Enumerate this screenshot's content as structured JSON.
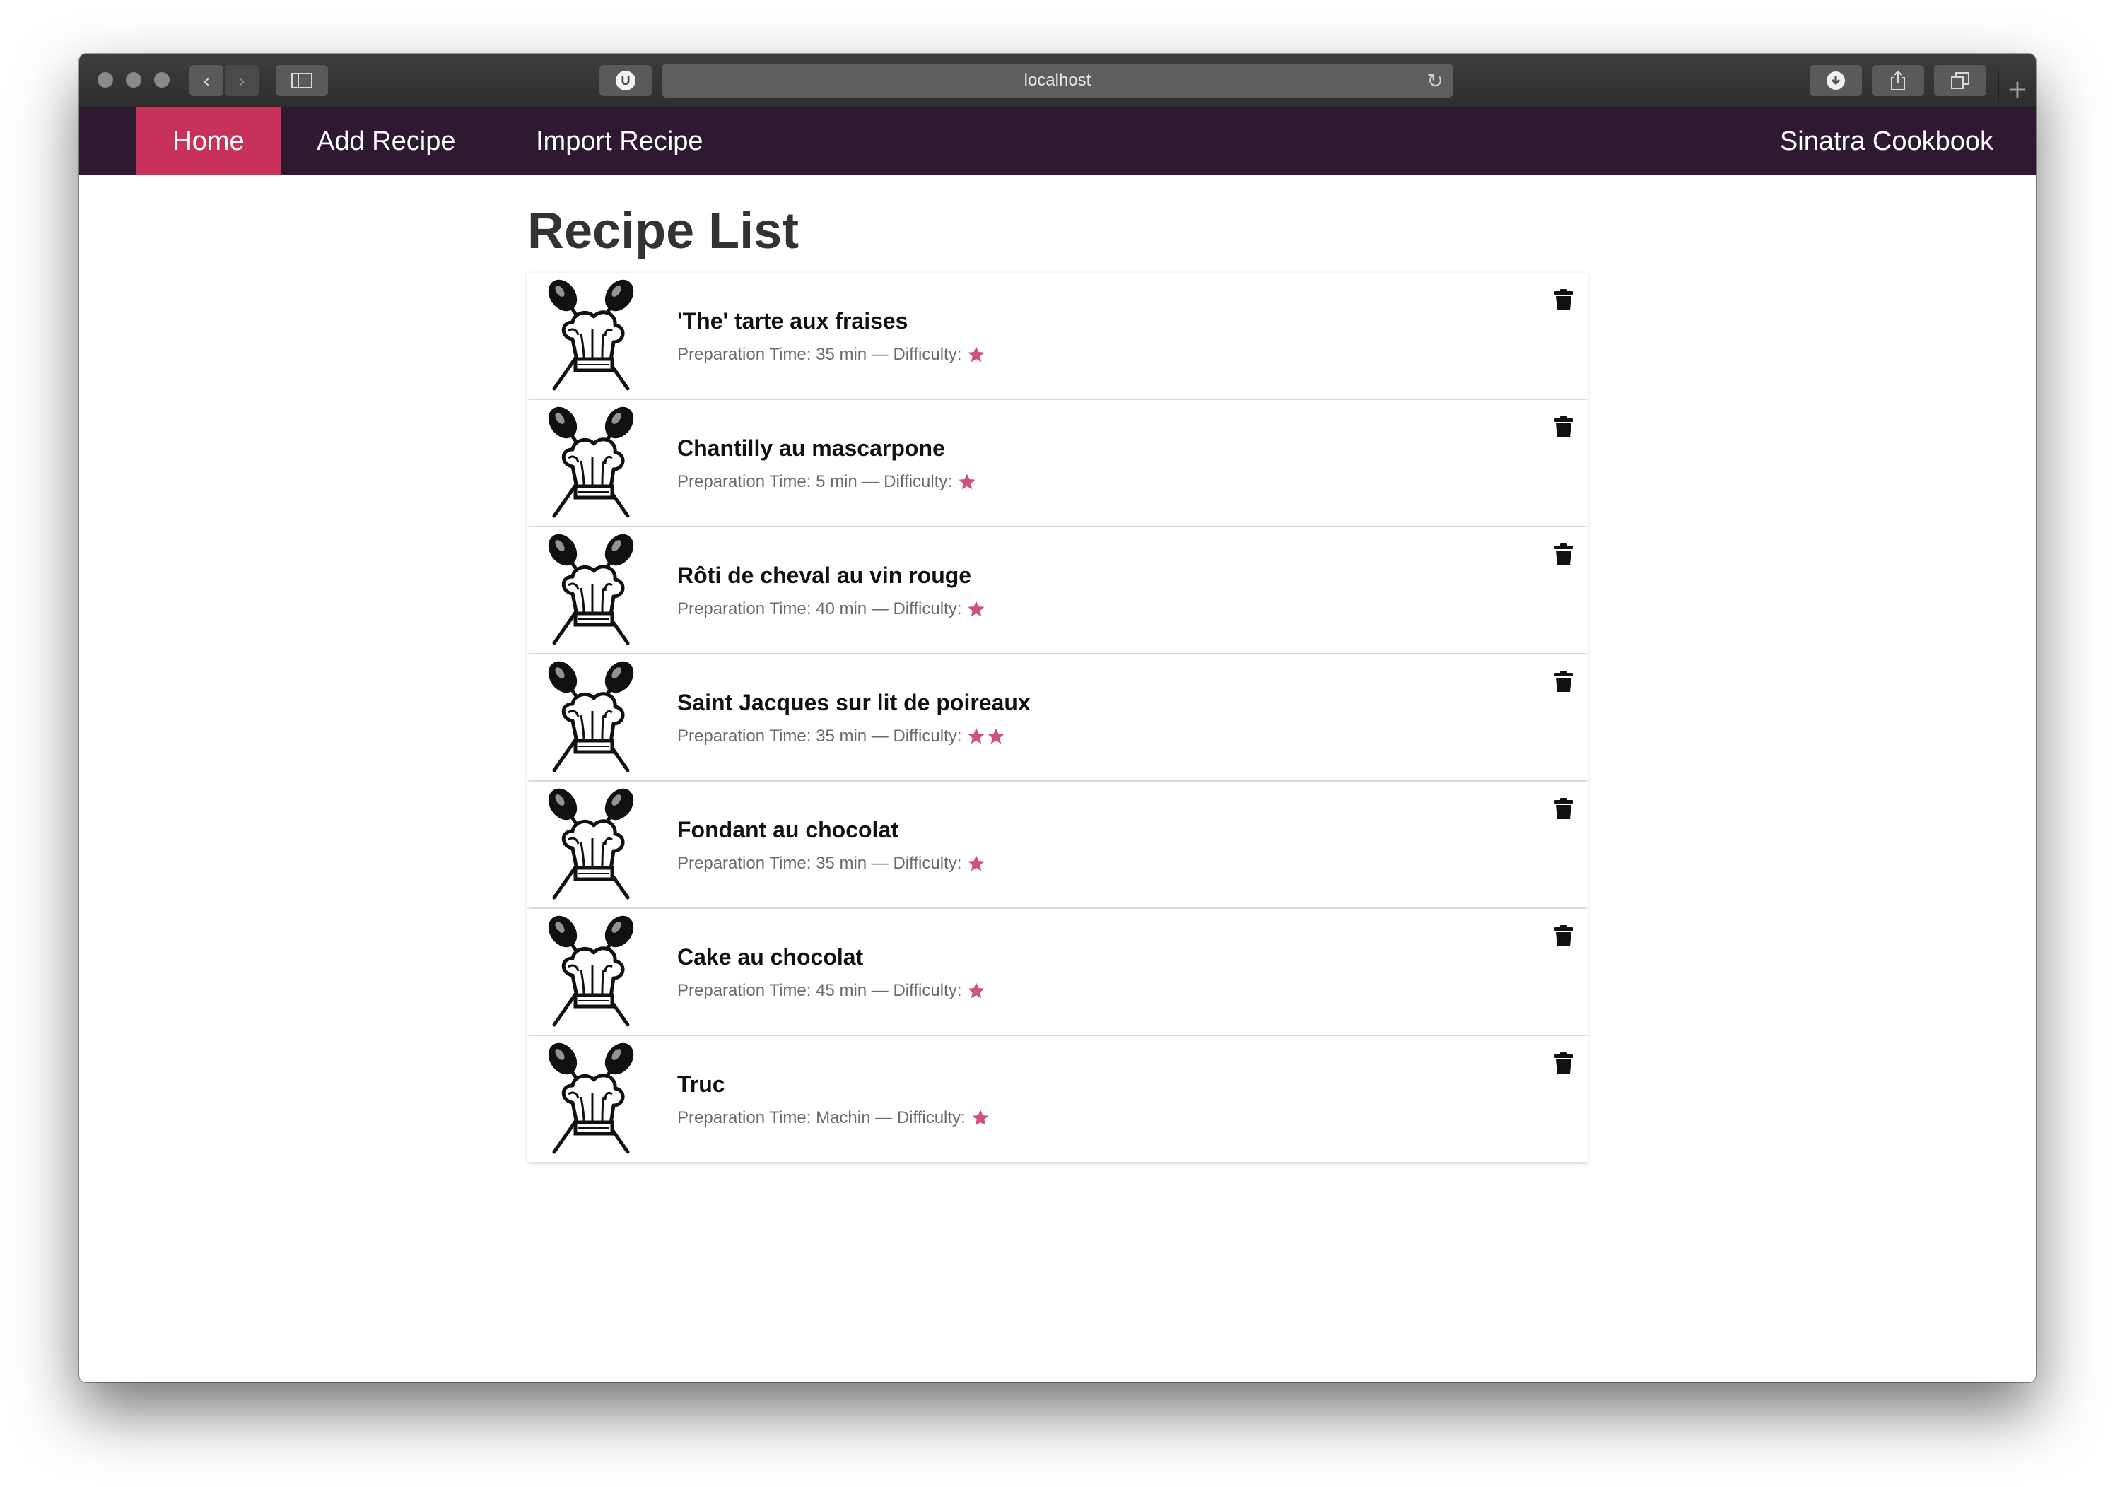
{
  "browser": {
    "url": "localhost",
    "reload_glyph": "↻",
    "back_glyph": "‹",
    "forward_glyph": "›",
    "newtab_glyph": "+"
  },
  "nav": {
    "items": [
      {
        "label": "Home",
        "active": true
      },
      {
        "label": "Add Recipe",
        "active": false
      },
      {
        "label": "Import Recipe",
        "active": false
      }
    ],
    "brand": "Sinatra Cookbook"
  },
  "page": {
    "title": "Recipe List"
  },
  "colors": {
    "nav_bg": "#2e1931",
    "nav_active": "#c8325a",
    "star": "#d0517a"
  },
  "icons": {
    "recipe": "crossed-spoons-chef-hat-icon",
    "delete": "trash-icon",
    "star": "star-icon"
  },
  "recipes": [
    {
      "title": "'The' tarte aux fraises",
      "prep": "Preparation Time: 35 min",
      "sep": " — ",
      "difficulty_label": "Difficulty:",
      "difficulty": 1
    },
    {
      "title": "Chantilly au mascarpone",
      "prep": "Preparation Time: 5 min",
      "sep": " — ",
      "difficulty_label": "Difficulty:",
      "difficulty": 1
    },
    {
      "title": "Rôti de cheval au vin rouge",
      "prep": "Preparation Time: 40 min",
      "sep": " — ",
      "difficulty_label": "Difficulty:",
      "difficulty": 1
    },
    {
      "title": "Saint Jacques sur lit de poireaux",
      "prep": "Preparation Time: 35 min",
      "sep": " — ",
      "difficulty_label": "Difficulty:",
      "difficulty": 2
    },
    {
      "title": "Fondant au chocolat",
      "prep": "Preparation Time: 35 min",
      "sep": " — ",
      "difficulty_label": "Difficulty:",
      "difficulty": 1
    },
    {
      "title": "Cake au chocolat",
      "prep": "Preparation Time: 45 min",
      "sep": " — ",
      "difficulty_label": "Difficulty:",
      "difficulty": 1
    },
    {
      "title": "Truc",
      "prep": "Preparation Time: Machin",
      "sep": " — ",
      "difficulty_label": "Difficulty:",
      "difficulty": 1
    }
  ]
}
